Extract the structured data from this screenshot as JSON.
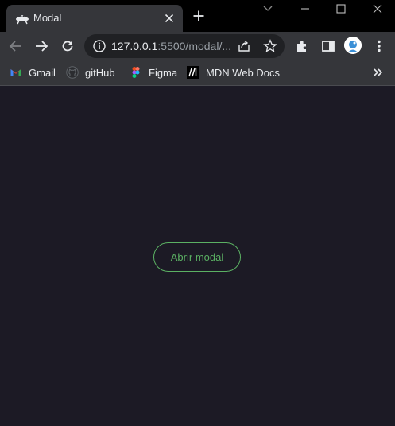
{
  "window": {
    "tab_title": "Modal"
  },
  "toolbar": {
    "url_host": "127.0.0.1",
    "url_rest": ":5500/modal/..."
  },
  "bookmarks": {
    "items": [
      {
        "label": "Gmail",
        "icon": "gmail-icon"
      },
      {
        "label": "gitHub",
        "icon": "github-icon"
      },
      {
        "label": "Figma",
        "icon": "figma-icon"
      },
      {
        "label": "MDN Web Docs",
        "icon": "mdn-icon"
      }
    ]
  },
  "page": {
    "open_modal_label": "Abrir modal"
  },
  "colors": {
    "page_background": "#1c1a25",
    "accent_green": "#5bb163",
    "chrome_toolbar": "#35363a",
    "titlebar": "#000000"
  }
}
